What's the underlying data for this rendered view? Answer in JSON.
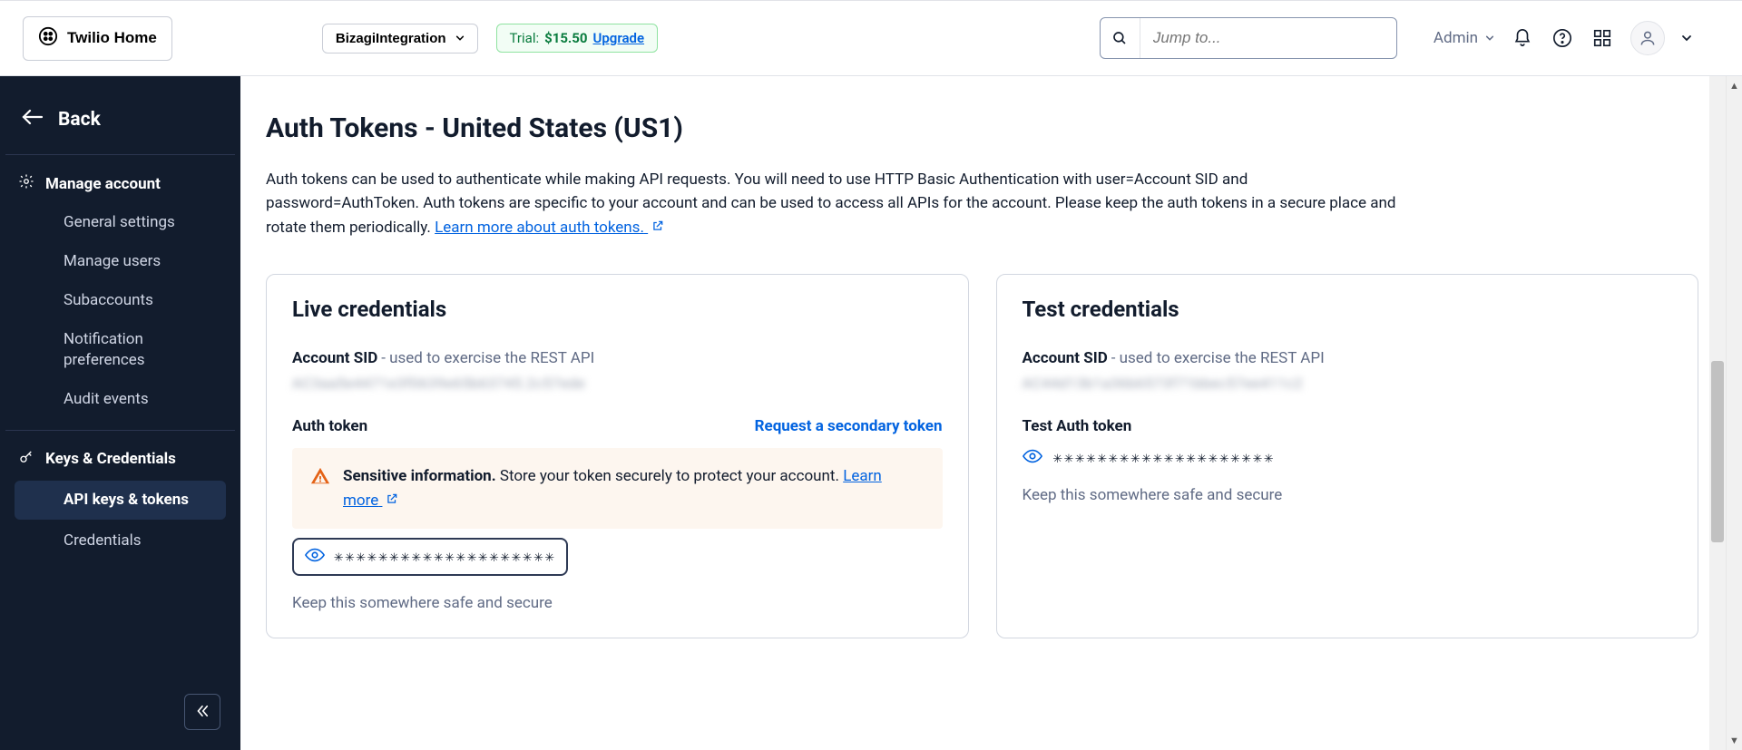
{
  "topbar": {
    "home_label": "Twilio Home",
    "account_name": "BizagiIntegration",
    "trial_prefix": "Trial:",
    "trial_amount": "$15.50",
    "upgrade": "Upgrade",
    "search_placeholder": "Jump to...",
    "admin_label": "Admin"
  },
  "sidebar": {
    "back": "Back",
    "section_manage": "Manage account",
    "items_manage": [
      "General settings",
      "Manage users",
      "Subaccounts",
      "Notification preferences",
      "Audit events"
    ],
    "section_keys": "Keys & Credentials",
    "items_keys": [
      "API keys & tokens",
      "Credentials"
    ]
  },
  "page": {
    "title": "Auth Tokens - United States (US1)",
    "desc": "Auth tokens can be used to authenticate while making API requests. You will need to use HTTP Basic Authentication with user=Account SID and password=AuthToken. Auth tokens are specific to your account and can be used to access all APIs for the account. Please keep the auth tokens in a secure place and rotate them periodically. ",
    "desc_link": "Learn more about auth tokens."
  },
  "live": {
    "heading": "Live credentials",
    "sid_label": "Account SID",
    "sid_desc": "- used to exercise the REST API",
    "sid_value": "AC3aa5e4471e3f0639e65b63745.2c57ede",
    "auth_label": "Auth token",
    "secondary_link": "Request a secondary token",
    "info_bold": "Sensitive information.",
    "info_text": " Store your token securely to protect your account. ",
    "info_link": "Learn more",
    "token_masked": "✳✳✳✳✳✳✳✳✳✳✳✳✳✳✳✳✳✳✳✳",
    "hint": "Keep this somewhere safe and secure"
  },
  "test": {
    "heading": "Test credentials",
    "sid_label": "Account SID",
    "sid_desc": "- used to exercise the REST API",
    "sid_value": "AC44d13b1a36b6573f71bbec57ee411c2",
    "auth_label": "Test Auth token",
    "token_masked": "✳✳✳✳✳✳✳✳✳✳✳✳✳✳✳✳✳✳✳✳",
    "hint": "Keep this somewhere safe and secure"
  }
}
